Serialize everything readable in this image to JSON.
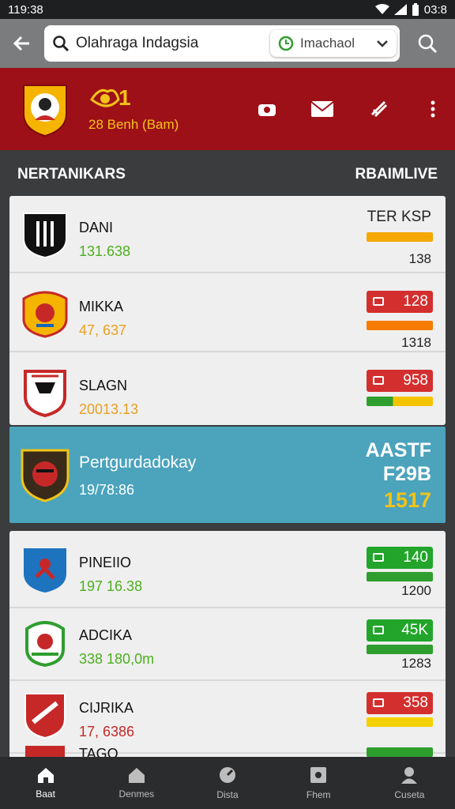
{
  "status_bar": {
    "time": "119:38",
    "battery_time": "03:8"
  },
  "search": {
    "query": "Olahraga Indagsia",
    "chip_label": "Imachaol"
  },
  "header": {
    "badge_number": "1",
    "subtitle": "28 Benh (Bam)"
  },
  "sections": {
    "left": "NERTANIKARS",
    "right": "RBAIMLIVE"
  },
  "rows_top": [
    {
      "name": "DANI",
      "value": "131.638",
      "value_color": "#4caf1e",
      "tag": "TER KSP",
      "tag_style": "plain",
      "bar_color": "#f5a800",
      "bar_num": "138"
    },
    {
      "name": "MIKKA",
      "value": "47, 637",
      "value_color": "#e8a020",
      "tag": "128",
      "tag_style": "red",
      "bar_color": "#f57c00",
      "bar_num": "1318"
    },
    {
      "name": "SLAGN",
      "value": "20013.13",
      "value_color": "#e8a020",
      "tag": "958",
      "tag_style": "red",
      "bar_color": "#8bc34a",
      "bar_num": ""
    }
  ],
  "highlight": {
    "name": "Pertgurdadokay",
    "value": "19/78:86",
    "r1": "AASTF",
    "r2": "F29B",
    "r3": "1517"
  },
  "rows_bottom": [
    {
      "name": "PINEIIO",
      "value": "197 16.38",
      "value_color": "#4caf1e",
      "tag": "140",
      "tag_style": "green",
      "bar_color": "#2e9e2e",
      "bar_num": "1200"
    },
    {
      "name": "ADCIKA",
      "value": "338 180,0m",
      "value_color": "#4caf1e",
      "tag": "45K",
      "tag_style": "green",
      "bar_color": "#2e9e2e",
      "bar_num": "1283"
    },
    {
      "name": "CIJRIKA",
      "value": "17, 6386",
      "value_color": "#c62828",
      "tag": "358",
      "tag_style": "red",
      "bar_color": "#f5d000",
      "bar_num": ""
    },
    {
      "name": "TAGO",
      "value": "",
      "value_color": "#222",
      "tag": "",
      "tag_style": "green",
      "bar_color": "#2e9e2e",
      "bar_num": ""
    }
  ],
  "nav": [
    {
      "label": "Baat",
      "icon": "home-icon",
      "active": true
    },
    {
      "label": "Denmes",
      "icon": "house-icon",
      "active": false
    },
    {
      "label": "Dista",
      "icon": "clock-icon",
      "active": false
    },
    {
      "label": "Fhem",
      "icon": "calendar-icon",
      "active": false
    },
    {
      "label": "Cuseta",
      "icon": "profile-icon",
      "active": false
    }
  ],
  "colors": {
    "header_red": "#9e1017",
    "highlight_blue": "#4ba3bc",
    "tag_red": "#d32f2f",
    "tag_green": "#22a52a",
    "gold": "#f2c318"
  }
}
